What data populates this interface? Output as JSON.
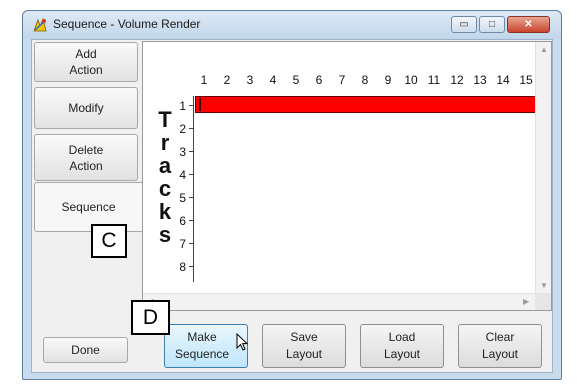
{
  "window": {
    "title": "Sequence - Volume Render",
    "min_glyph": "▭",
    "max_glyph": "□",
    "close_glyph": "✕"
  },
  "sidebar": {
    "items": [
      {
        "label": "Add\nAction"
      },
      {
        "label": "Modify"
      },
      {
        "label": "Delete\nAction"
      },
      {
        "label": "Sequence",
        "active": true
      }
    ],
    "done_label": "Done"
  },
  "grid": {
    "columns": [
      "1",
      "2",
      "3",
      "4",
      "5",
      "6",
      "7",
      "8",
      "9",
      "10",
      "11",
      "12",
      "13",
      "14",
      "15"
    ],
    "tracks_label": [
      "T",
      "r",
      "a",
      "c",
      "k",
      "s"
    ],
    "rows": [
      "1",
      "2",
      "3",
      "4",
      "5",
      "6",
      "7",
      "8"
    ],
    "track_color": "#ff0000"
  },
  "buttons": {
    "make_sequence": "Make\nSequence",
    "save_layout": "Save\nLayout",
    "load_layout": "Load\nLayout",
    "clear_layout": "Clear\nLayout"
  },
  "callouts": {
    "c": "C",
    "d": "D"
  },
  "scroll": {
    "up": "▲",
    "down": "▼",
    "left": "◀",
    "right": "▶"
  }
}
